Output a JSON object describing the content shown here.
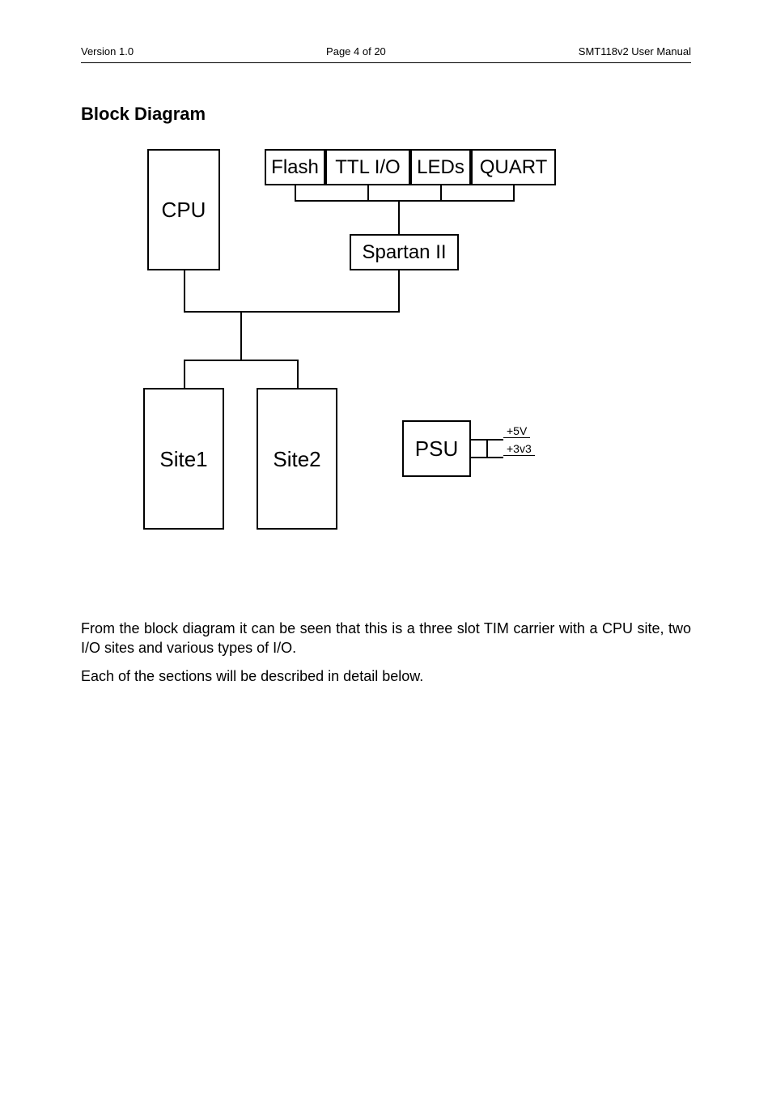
{
  "header": {
    "left": "Version 1.0",
    "center": "Page 4 of 20",
    "right": "SMT118v2 User Manual"
  },
  "section_title": "Block Diagram",
  "diagram": {
    "cpu": "CPU",
    "flash": "Flash",
    "ttl_io": "TTL I/O",
    "leds": "LEDs",
    "quart": "QUART",
    "spartan": "Spartan II",
    "site1": "Site1",
    "site2": "Site2",
    "psu": "PSU",
    "psu_out_top": "+5V",
    "psu_out_bottom": "+3v3"
  },
  "body": {
    "p1": "From the block diagram it can be seen that this is a three slot TIM carrier with a CPU site, two I/O sites and various types of I/O.",
    "p2": "Each of the sections will be described in detail below."
  }
}
